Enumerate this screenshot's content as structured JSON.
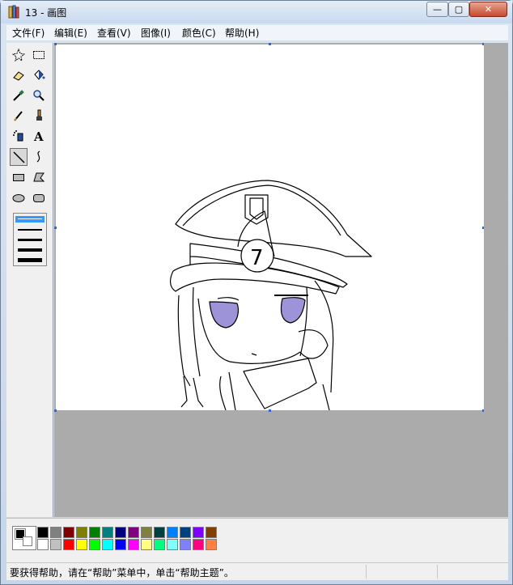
{
  "window": {
    "title": "13 - 画图",
    "minimize_glyph": "—",
    "maximize_glyph": "▢",
    "close_glyph": "✕"
  },
  "menu": {
    "items": [
      "文件(F)",
      "编辑(E)",
      "查看(V)",
      "图像(I)",
      "颜色(C)",
      "帮助(H)"
    ]
  },
  "tools": [
    "free-form-select",
    "select",
    "eraser",
    "fill-with-color",
    "pick-color",
    "magnifier",
    "pencil",
    "brush",
    "airbrush",
    "text",
    "line",
    "curve",
    "rectangle",
    "polygon",
    "ellipse",
    "rounded-rectangle"
  ],
  "selected_tool": "line",
  "palette": {
    "foreground": "#000000",
    "background": "#ffffff",
    "colors_row1": [
      "#000000",
      "#808080",
      "#800000",
      "#808000",
      "#008000",
      "#008080",
      "#000080",
      "#800080",
      "#808040",
      "#004040",
      "#0080ff",
      "#004080",
      "#8000ff",
      "#804000"
    ],
    "colors_row2": [
      "#ffffff",
      "#c0c0c0",
      "#ff0000",
      "#ffff00",
      "#00ff00",
      "#00ffff",
      "#0000ff",
      "#ff00ff",
      "#ffff80",
      "#00ff80",
      "#80ffff",
      "#8080ff",
      "#ff0080",
      "#ff8040"
    ]
  },
  "drawing": {
    "eye_color": "#9c93d8",
    "badge_number": "7"
  },
  "status": {
    "text": "要获得帮助，请在“帮助”菜单中，单击“帮助主题”。"
  }
}
